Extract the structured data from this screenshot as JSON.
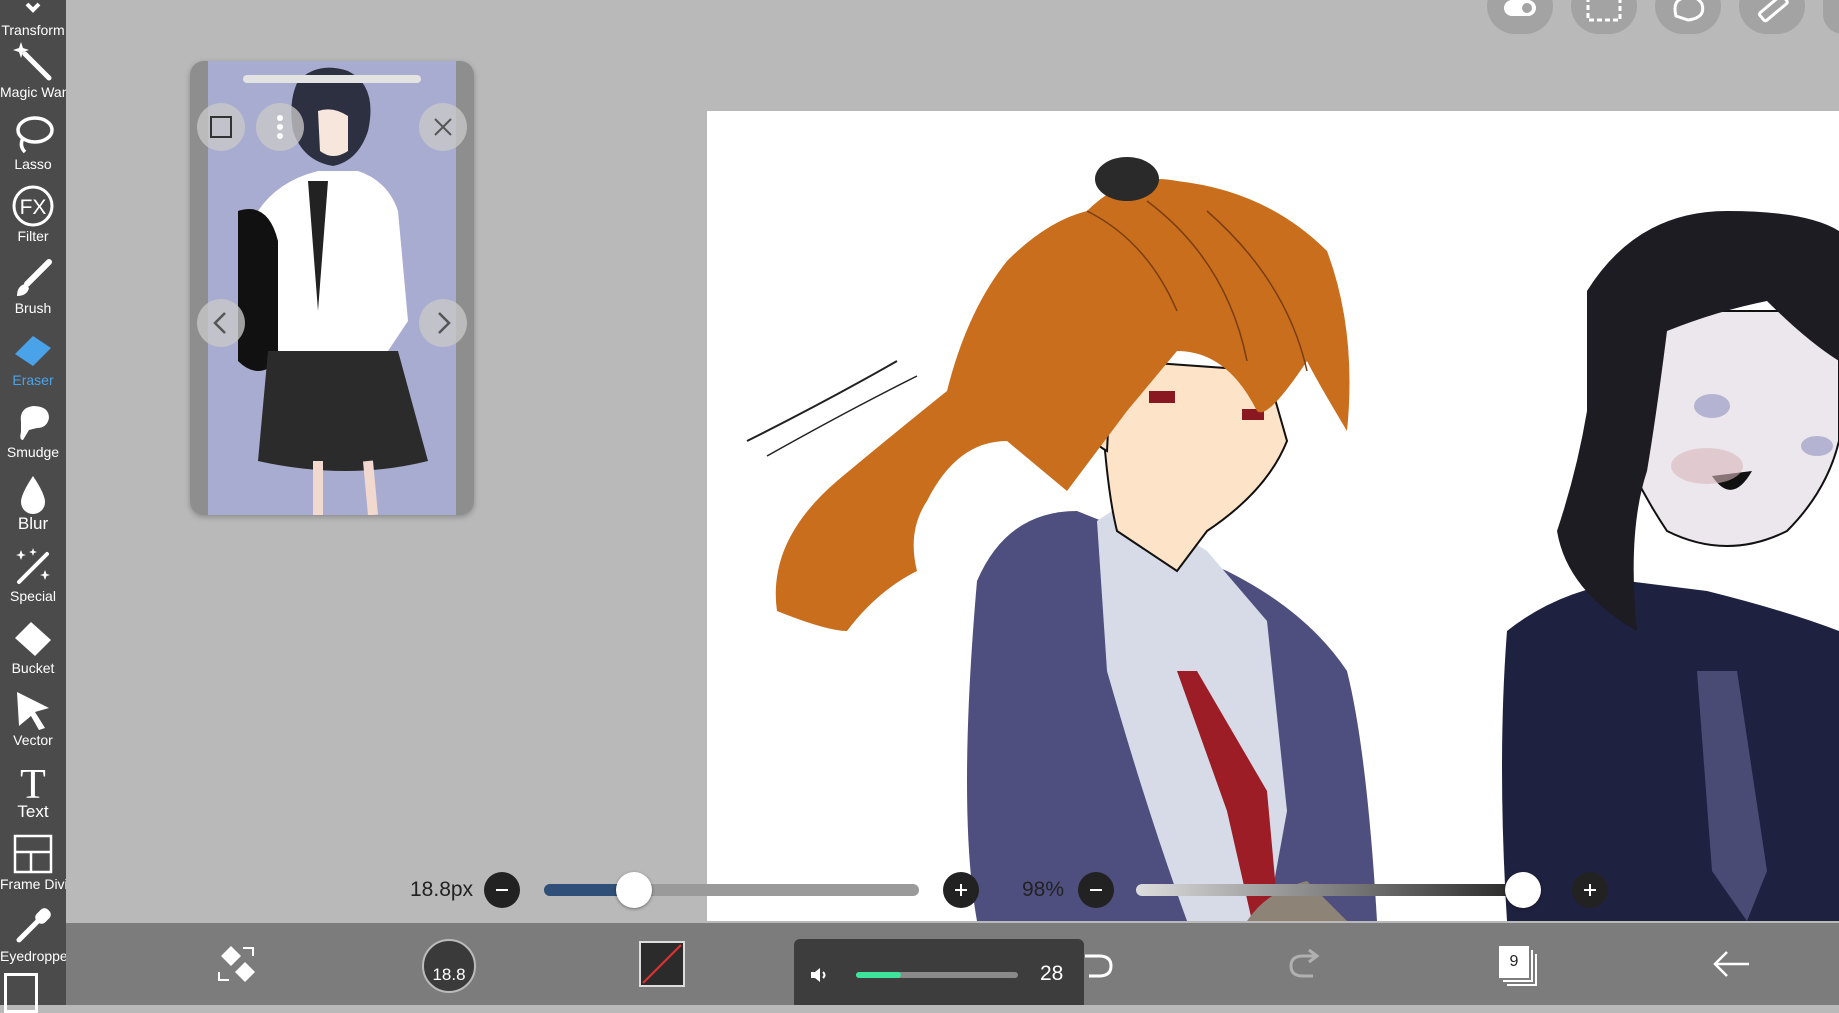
{
  "toolbar": {
    "items": [
      {
        "label": "Transform",
        "icon": "transform-icon"
      },
      {
        "label": "Magic Wand",
        "icon": "magic-wand-icon"
      },
      {
        "label": "Lasso",
        "icon": "lasso-icon"
      },
      {
        "label": "Filter",
        "icon": "fx-icon",
        "glyph": "FX"
      },
      {
        "label": "Brush",
        "icon": "brush-icon"
      },
      {
        "label": "Eraser",
        "icon": "eraser-icon",
        "active": true
      },
      {
        "label": "Smudge",
        "icon": "smudge-icon"
      },
      {
        "label": "Blur",
        "icon": "blur-drop-icon"
      },
      {
        "label": "Special",
        "icon": "special-wand-icon"
      },
      {
        "label": "Bucket",
        "icon": "bucket-icon"
      },
      {
        "label": "Vector",
        "icon": "vector-arrow-icon"
      },
      {
        "label": "Text",
        "icon": "text-icon",
        "glyph": "T"
      },
      {
        "label": "Frame Divider",
        "icon": "frame-divider-icon"
      },
      {
        "label": "Eyedropper",
        "icon": "eyedropper-icon"
      }
    ]
  },
  "colors": {
    "toolbar_bg": "#4b4b4b",
    "active_tool": "#4aa3e8",
    "workspace_bg": "#b9b9b9",
    "bottom_bar_bg": "#7c7c7c",
    "slider_fill": "#2f4f78",
    "volume_fill": "#3fe29a"
  },
  "top_buttons": [
    "toggle-icon",
    "selection-rect-icon",
    "lasso-select-icon",
    "ruler-icon"
  ],
  "reference_window": {
    "buttons": [
      "square-icon",
      "more-vertical-icon",
      "close-icon",
      "chevron-left-icon",
      "chevron-right-icon"
    ]
  },
  "brush_size": {
    "value_text": "18.8px",
    "level": 0.24
  },
  "opacity": {
    "value_text": "98%",
    "level": 0.98
  },
  "bottom_bar": {
    "brush_preview_value": "18.8",
    "layer_count": "9",
    "icons": [
      "swap-tool-icon",
      "brush-size-preview",
      "color-swatch-icon",
      "undo-icon",
      "redo-icon",
      "layers-icon",
      "back-arrow-icon"
    ]
  },
  "volume": {
    "value": "28",
    "level": 0.28,
    "icon": "speaker-icon"
  }
}
